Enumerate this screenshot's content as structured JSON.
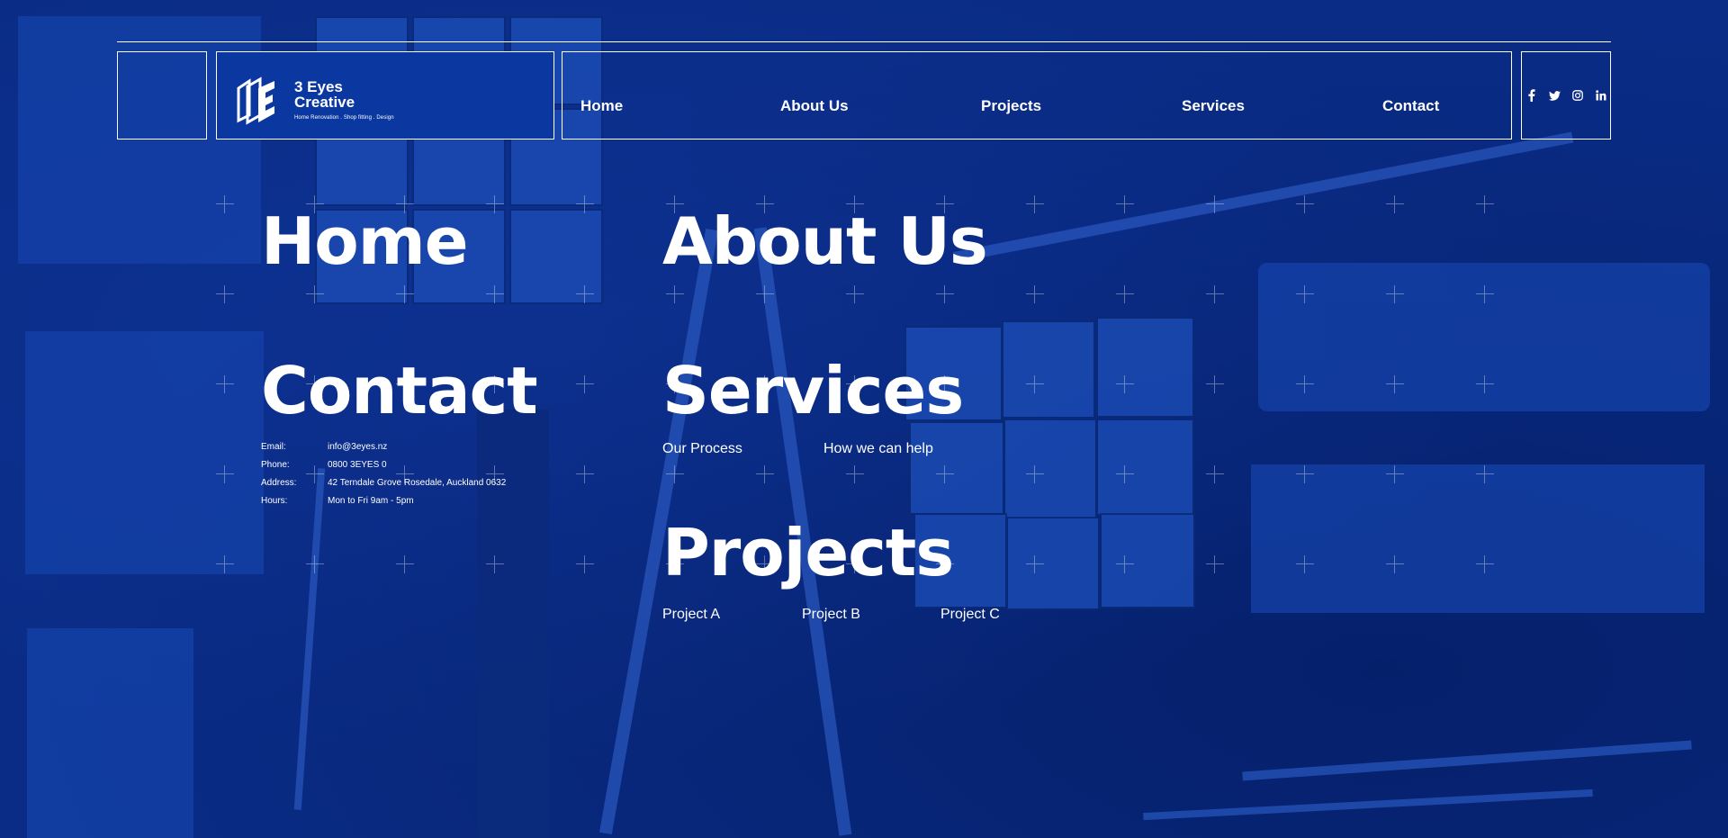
{
  "brand": {
    "name_line1": "3 Eyes",
    "name_line2": "Creative",
    "tagline": "Home Renovation . Shop fitting . Design"
  },
  "nav": {
    "items": [
      {
        "label": "Home"
      },
      {
        "label": "About Us"
      },
      {
        "label": "Projects"
      },
      {
        "label": "Services"
      },
      {
        "label": "Contact"
      }
    ]
  },
  "social": {
    "icons": [
      "facebook-icon",
      "twitter-icon",
      "instagram-icon",
      "linkedin-icon"
    ]
  },
  "sections": {
    "home": {
      "title": "Home"
    },
    "about": {
      "title": "About Us"
    },
    "contact": {
      "title": "Contact",
      "rows": [
        {
          "label": "Email:",
          "value": "info@3eyes.nz"
        },
        {
          "label": "Phone:",
          "value": "0800 3EYES 0"
        },
        {
          "label": "Address:",
          "value": "42 Terndale Grove Rosedale, Auckland 0632"
        },
        {
          "label": "Hours:",
          "value": "Mon to Fri 9am - 5pm"
        }
      ]
    },
    "services": {
      "title": "Services",
      "links": [
        "Our Process",
        "How we can help"
      ]
    },
    "projects": {
      "title": "Projects",
      "links": [
        "Project A",
        "Project B",
        "Project C"
      ]
    }
  },
  "colors": {
    "background": "#0a2c86",
    "logo_box": "#0a38a0",
    "text": "#ffffff"
  }
}
